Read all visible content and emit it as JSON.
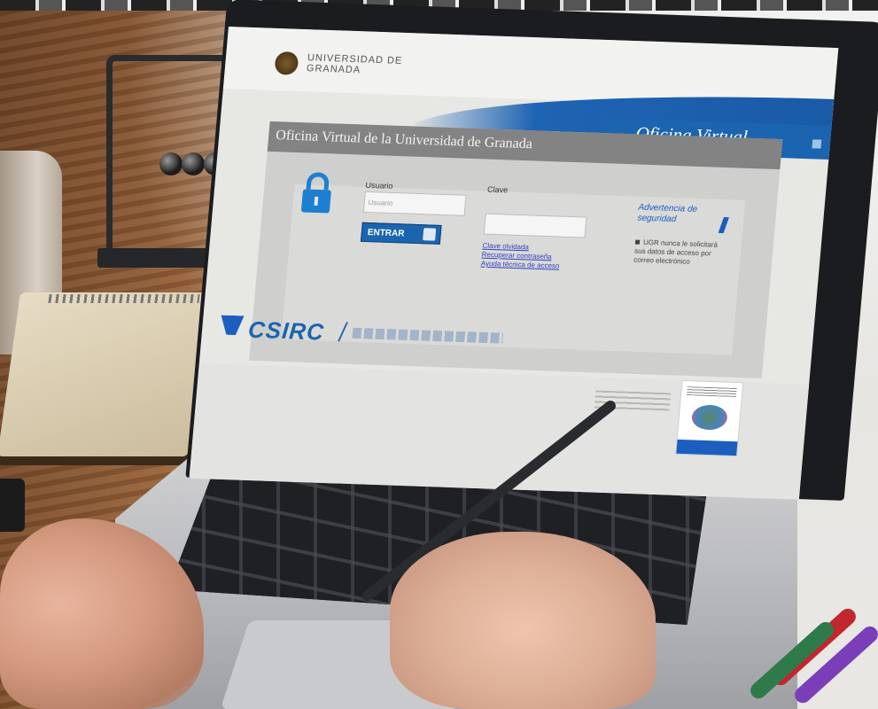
{
  "screen": {
    "university_name": "UNIVERSIDAD DE GRANADA",
    "banner_title": "Oficina Virtual",
    "panel_title": "Oficina Virtual de la Universidad de Granada",
    "login": {
      "user_label": "Usuario",
      "user_placeholder": "Usuario",
      "password_label": "Clave",
      "enter_button": "ENTRAR"
    },
    "help_links": [
      "Clave olvidada",
      "Recuperar contraseña",
      "Ayuda técnica de acceso"
    ],
    "security": {
      "title": "Advertencia de seguridad",
      "text": "UGR nunca le solicitará sus datos de acceso por correo electrónico"
    },
    "footer": {
      "brand": "CSIRC"
    }
  },
  "colors": {
    "accent_blue": "#1b64b0",
    "panel_grey": "#838383",
    "link_blue": "#3340c0"
  }
}
